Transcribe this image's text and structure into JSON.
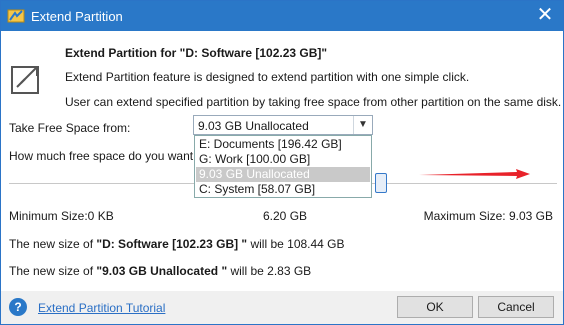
{
  "window": {
    "title": "Extend Partition"
  },
  "header": {
    "heading": "Extend Partition for \"D: Software [102.23 GB]\"",
    "desc1": "Extend Partition feature is designed to extend partition with one simple click.",
    "desc2": "User can extend specified partition by taking free space from other partition on the same disk."
  },
  "take_from": {
    "label": "Take Free Space from:",
    "selected": "9.03 GB Unallocated",
    "options": [
      "E: Documents [196.42 GB]",
      "G: Work [100.00 GB]",
      "9.03 GB Unallocated",
      "C: System [58.07 GB]"
    ]
  },
  "how_much": {
    "label": "How much free space do you want"
  },
  "slider": {
    "min_label": "Minimum Size:0 KB",
    "mid_label": "6.20 GB",
    "max_label": "Maximum Size: 9.03 GB"
  },
  "result": {
    "line1_prefix": "The new size of ",
    "line1_bold": "\"D: Software [102.23 GB] \"",
    "line1_suffix": " will be 108.44 GB",
    "line2_prefix": "The new size of ",
    "line2_bold": "\"9.03 GB Unallocated \"",
    "line2_suffix": " will be 2.83 GB"
  },
  "footer": {
    "help_glyph": "?",
    "tutorial": "Extend Partition Tutorial",
    "ok": "OK",
    "cancel": "Cancel"
  },
  "colors": {
    "titlebar": "#2a78c8",
    "link": "#2a6fc5",
    "arrow": "#e8222a"
  },
  "icons": {
    "app": "partition-app-icon",
    "extend": "extend-arrows-icon",
    "close": "close-icon",
    "help": "help-icon",
    "dropdown": "chevron-down-icon"
  }
}
